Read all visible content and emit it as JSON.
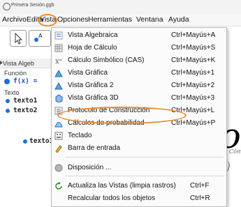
{
  "window": {
    "title": "Primera Sesión.ggb"
  },
  "menubar": {
    "items": [
      "Archivo",
      "Edita",
      "Vista",
      "Opciones",
      "Herramientas",
      "Ventana",
      "Ayuda"
    ]
  },
  "algebra_panel": {
    "header": "Vista Algeb",
    "groups": [
      "Función",
      "Texto"
    ],
    "rows": [
      "f(x) =",
      "texto1",
      "texto2",
      "texto3"
    ]
  },
  "graphics": {
    "big_text": "Io",
    "small_text": "Cómo",
    "formula": "x)"
  },
  "vista_menu": {
    "items": [
      {
        "label": "Vista Algebraica",
        "shortcut": "Ctrl+Mayús+A",
        "icon": "algebra-view-icon"
      },
      {
        "label": "Hoja de Cálculo",
        "shortcut": "Ctrl+Mayús+S",
        "icon": "spreadsheet-icon"
      },
      {
        "label": "Cálculo Simbólico (CAS)",
        "shortcut": "Ctrl+Mayús+K",
        "icon": "cas-icon"
      },
      {
        "label": "Vista Gráfica",
        "shortcut": "Ctrl+Mayús+1",
        "icon": "graphics-view-icon"
      },
      {
        "label": "Vista Gráfica 2",
        "shortcut": "Ctrl+Mayús+2",
        "icon": "graphics-view-2-icon"
      },
      {
        "label": "Vista Gráfica 3D",
        "shortcut": "Ctrl+Mayús+3",
        "icon": "graphics-3d-icon"
      },
      {
        "label": "Protocolo de Construcción",
        "shortcut": "Ctrl+Mayús+L",
        "icon": "construction-protocol-icon"
      },
      {
        "label": "Cálculos de probabilidad",
        "shortcut": "Ctrl+Mayús+P",
        "icon": "probability-icon"
      },
      {
        "label": "Teclado",
        "shortcut": "",
        "icon": "keyboard-icon"
      },
      {
        "label": "Barra de entrada",
        "shortcut": "",
        "icon": "input-bar-icon"
      },
      {
        "label": "Disposición ...",
        "shortcut": "",
        "icon": "layout-icon"
      },
      {
        "label": "Actualiza las Vistas (limpia rastros)",
        "shortcut": "Ctrl+F",
        "icon": "refresh-views-icon"
      },
      {
        "label": "Recalcular todos los objetos",
        "shortcut": "Ctrl+R",
        "icon": ""
      }
    ]
  },
  "colors": {
    "accent": "#ef8a2f",
    "object_dot": "#1d6fd2"
  }
}
